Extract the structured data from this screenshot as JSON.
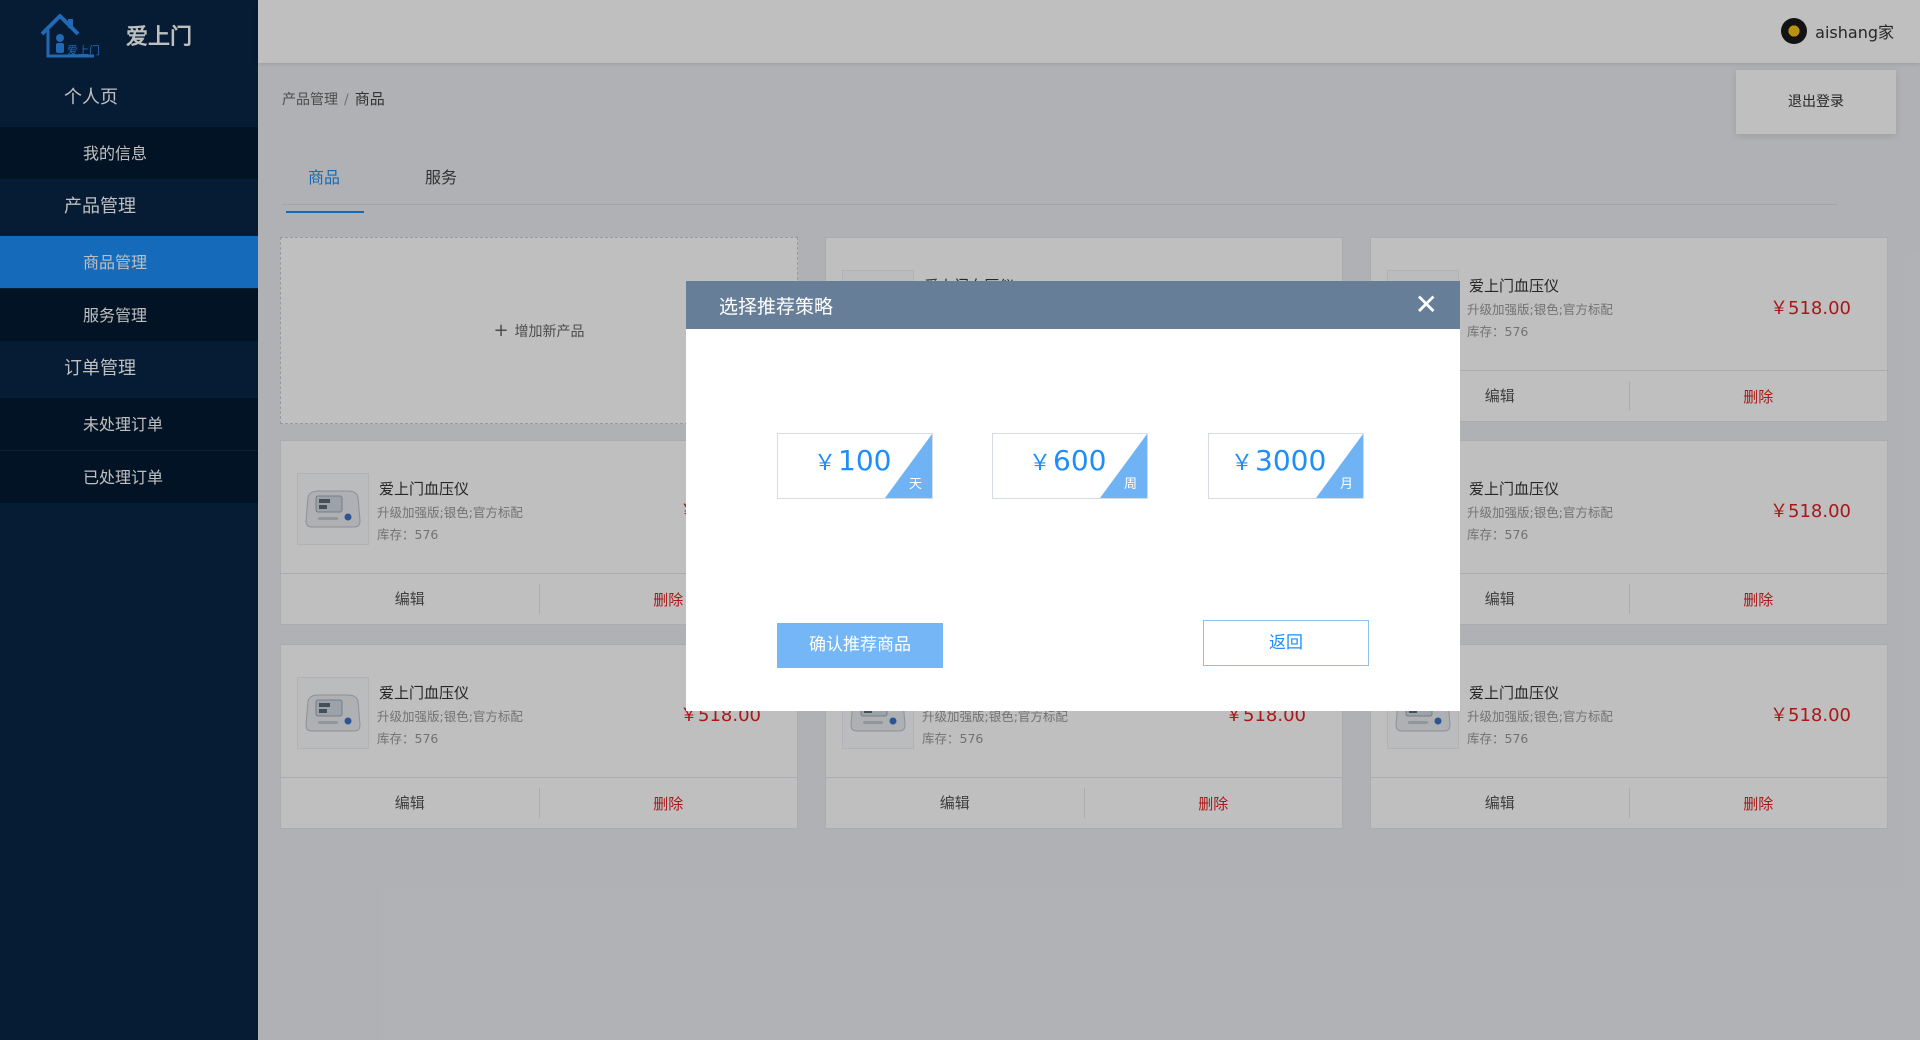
{
  "brand": {
    "name": "爱上门",
    "logo_text": "爱上门"
  },
  "sidebar": {
    "groups": [
      {
        "label": "个人页",
        "items": [
          {
            "label": "我的信息"
          }
        ]
      },
      {
        "label": "产品管理",
        "items": [
          {
            "label": "商品管理",
            "active": true
          },
          {
            "label": "服务管理"
          }
        ]
      },
      {
        "label": "订单管理",
        "items": [
          {
            "label": "未处理订单"
          },
          {
            "label": "已处理订单"
          }
        ]
      }
    ]
  },
  "header": {
    "username": "aishang家",
    "logout_label": "退出登录"
  },
  "breadcrumb": {
    "parent": "产品管理",
    "separator": "/",
    "current": "商品"
  },
  "tabs": [
    {
      "label": "商品",
      "active": true
    },
    {
      "label": "服务"
    }
  ],
  "add_card": {
    "plus": "+",
    "label": "增加新产品"
  },
  "product": {
    "title": "爱上门血压仪",
    "desc": "升级加强版;银色;官方标配",
    "stock": "库存：576",
    "price": "￥518.00",
    "edit_label": "编辑",
    "delete_label": "删除"
  },
  "modal": {
    "title": "选择推荐策略",
    "close_glyph": "✕",
    "strategies": [
      {
        "currency": "￥",
        "amount": "100",
        "unit": "天"
      },
      {
        "currency": "￥",
        "amount": "600",
        "unit": "周"
      },
      {
        "currency": "￥",
        "amount": "3000",
        "unit": "月"
      }
    ],
    "confirm_label": "确认推荐商品",
    "back_label": "返回"
  },
  "colors": {
    "sidebar_bg": "#082446",
    "accent": "#1e8ef8",
    "modal_header": "#667e98",
    "price_red": "#e02020"
  }
}
